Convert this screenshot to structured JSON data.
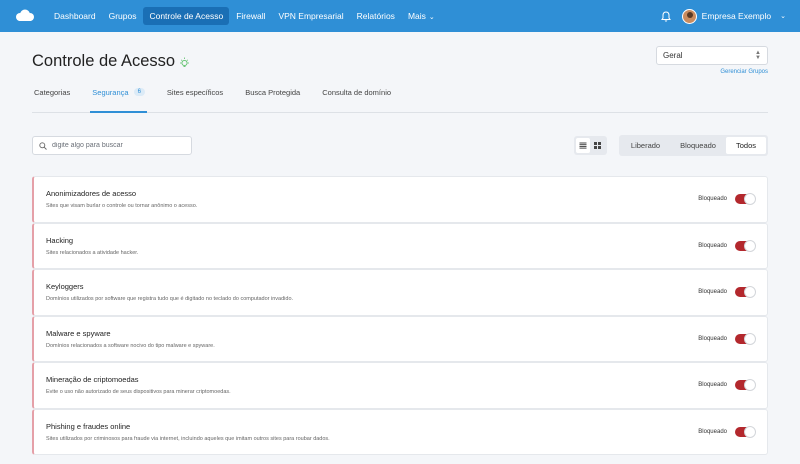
{
  "nav": {
    "items": [
      {
        "label": "Dashboard",
        "active": false
      },
      {
        "label": "Grupos",
        "active": false
      },
      {
        "label": "Controle de Acesso",
        "active": true
      },
      {
        "label": "Firewall",
        "active": false
      },
      {
        "label": "VPN Empresarial",
        "active": false
      },
      {
        "label": "Relatórios",
        "active": false
      }
    ],
    "more_label": "Mais",
    "user_name": "Empresa Exemplo",
    "accent": "#2f8fd6"
  },
  "header": {
    "title": "Controle de Acesso",
    "group_value": "Geral",
    "manage_link": "Gerenciar Grupos"
  },
  "tabs": [
    {
      "label": "Categorias"
    },
    {
      "label": "Segurança",
      "badge": "6"
    },
    {
      "label": "Sites específicos"
    },
    {
      "label": "Busca Protegida"
    },
    {
      "label": "Consulta de domínio"
    }
  ],
  "search": {
    "placeholder": "digite algo para buscar"
  },
  "filters": [
    "Liberado",
    "Bloqueado",
    "Todos"
  ],
  "items": [
    {
      "title": "Anonimizadores de acesso",
      "desc": "Sites que visam burlar o controle ou tornar anônimo o acesso.",
      "status": "Bloqueado"
    },
    {
      "title": "Hacking",
      "desc": "Sites relacionados a atividade hacker.",
      "status": "Bloqueado"
    },
    {
      "title": "Keyloggers",
      "desc": "Domínios utilizados por software que registra tudo que é digitado no teclado do computador invadido.",
      "status": "Bloqueado"
    },
    {
      "title": "Malware e spyware",
      "desc": "Domínios relacionados a software nocivo do tipo malware e spyware.",
      "status": "Bloqueado"
    },
    {
      "title": "Mineração de criptomoedas",
      "desc": "Evite o uso não autorizado de seus dispositivos para minerar criptomoedas.",
      "status": "Bloqueado"
    },
    {
      "title": "Phishing e fraudes online",
      "desc": "Sites utilizados por criminosos para fraude via internet, incluindo aqueles que imitam outros sites para roubar dados.",
      "status": "Bloqueado"
    }
  ],
  "icons": {
    "logo": "cloud-logo-icon",
    "bell": "bell-icon",
    "search": "search-icon",
    "list_view": "list-view-icon",
    "grid_view": "grid-view-icon",
    "bulb": "lightbulb-icon"
  },
  "colors": {
    "blocked_switch": "#b3282d",
    "card_accent": "#e5a0a8"
  }
}
